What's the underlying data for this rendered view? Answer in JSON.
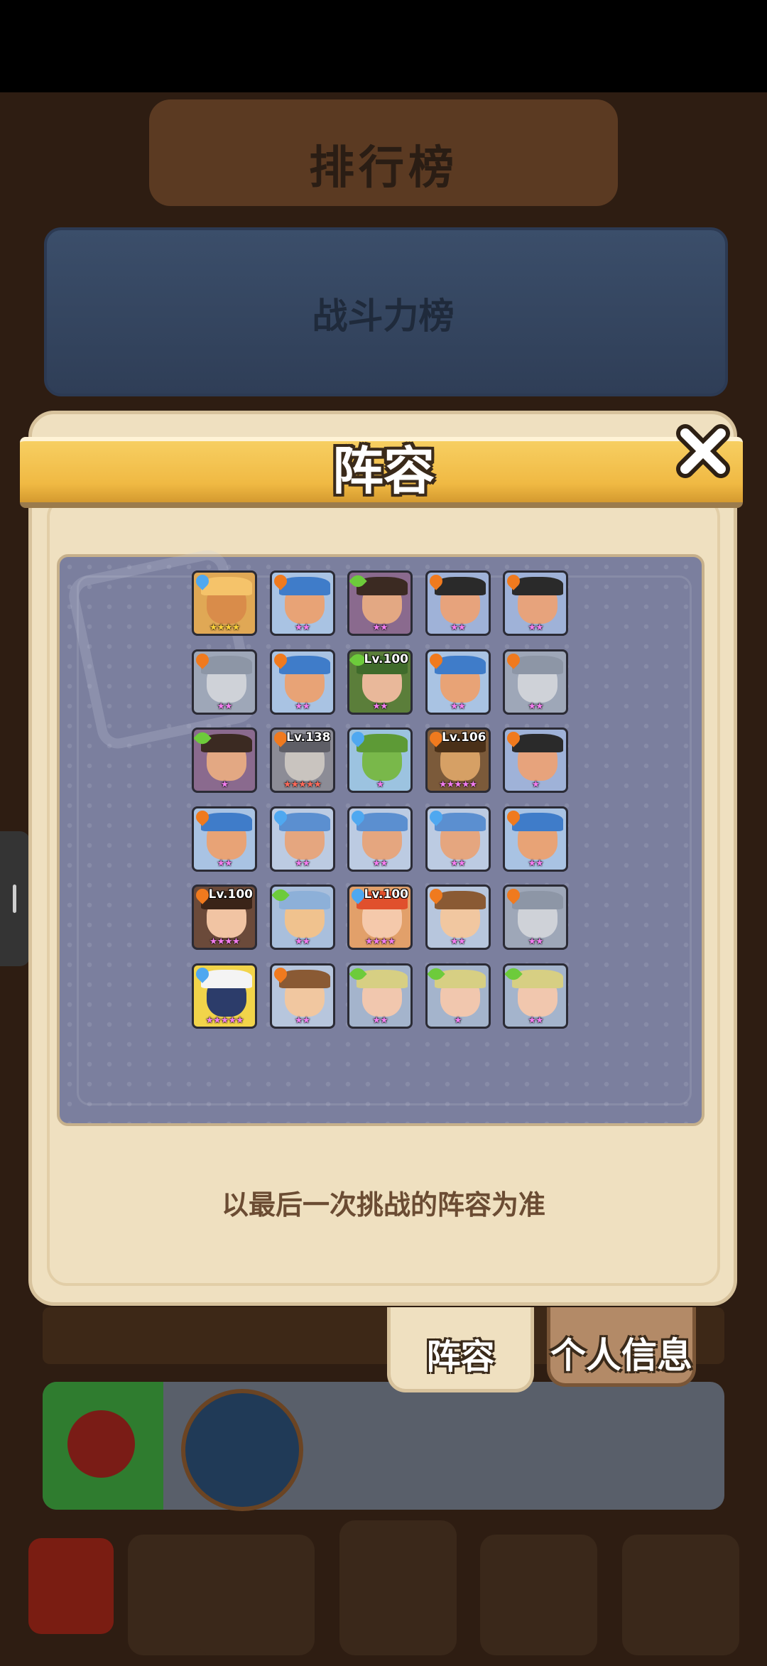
{
  "background": {
    "banner_title": "排行榜",
    "ranking_card_title": "战斗力榜"
  },
  "dialog": {
    "title": "阵容",
    "note": "以最后一次挑战的阵容为准"
  },
  "tabs": [
    {
      "label": "阵容",
      "selected": true
    },
    {
      "label": "个人信息",
      "selected": false
    }
  ],
  "heroes": [
    {
      "row": 1,
      "col": 1,
      "element": "water",
      "stars": "★★★★",
      "star_color": "gold",
      "level": "",
      "portrait": "golden-bunny-brute"
    },
    {
      "row": 1,
      "col": 2,
      "element": "fire",
      "stars": "★★",
      "star_color": "pink",
      "level": "",
      "portrait": "blue-bandana-pirate"
    },
    {
      "row": 1,
      "col": 3,
      "element": "leaf",
      "stars": "★★",
      "star_color": "pink",
      "level": "",
      "portrait": "bearded-caveman"
    },
    {
      "row": 1,
      "col": 4,
      "element": "fire",
      "stars": "★★",
      "star_color": "pink",
      "level": "",
      "portrait": "sunglasses-thug"
    },
    {
      "row": 1,
      "col": 5,
      "element": "fire",
      "stars": "★★",
      "star_color": "pink",
      "level": "",
      "portrait": "sunglasses-thug"
    },
    {
      "row": 2,
      "col": 1,
      "element": "fire",
      "stars": "★★",
      "star_color": "pink",
      "level": "",
      "portrait": "stone-golem"
    },
    {
      "row": 2,
      "col": 2,
      "element": "fire",
      "stars": "★★",
      "star_color": "pink",
      "level": "",
      "portrait": "blue-bandana-pirate"
    },
    {
      "row": 2,
      "col": 3,
      "element": "leaf",
      "stars": "★★",
      "star_color": "pink",
      "level": "Lv.100",
      "portrait": "green-hair-archer"
    },
    {
      "row": 2,
      "col": 4,
      "element": "fire",
      "stars": "★★",
      "star_color": "pink",
      "level": "",
      "portrait": "blue-bandana-pirate"
    },
    {
      "row": 2,
      "col": 5,
      "element": "fire",
      "stars": "★★",
      "star_color": "pink",
      "level": "",
      "portrait": "stone-golem"
    },
    {
      "row": 3,
      "col": 1,
      "element": "leaf",
      "stars": "★",
      "star_color": "pink",
      "level": "",
      "portrait": "bearded-caveman"
    },
    {
      "row": 3,
      "col": 2,
      "element": "fire",
      "stars": "★★★★★",
      "star_color": "red",
      "level": "Lv.138",
      "portrait": "silver-knight"
    },
    {
      "row": 3,
      "col": 3,
      "element": "water",
      "stars": "★",
      "star_color": "pink",
      "level": "",
      "portrait": "green-frog"
    },
    {
      "row": 3,
      "col": 4,
      "element": "fire",
      "stars": "★★★★★",
      "star_color": "pink",
      "level": "Lv.106",
      "portrait": "monkey-king"
    },
    {
      "row": 3,
      "col": 5,
      "element": "fire",
      "stars": "★",
      "star_color": "pink",
      "level": "",
      "portrait": "sunglasses-thug"
    },
    {
      "row": 4,
      "col": 1,
      "element": "fire",
      "stars": "★★",
      "star_color": "pink",
      "level": "",
      "portrait": "blue-bandana-pirate"
    },
    {
      "row": 4,
      "col": 2,
      "element": "water",
      "stars": "★★",
      "star_color": "pink",
      "level": "",
      "portrait": "blue-hood-soldier"
    },
    {
      "row": 4,
      "col": 3,
      "element": "water",
      "stars": "★★",
      "star_color": "pink",
      "level": "",
      "portrait": "blue-hood-soldier"
    },
    {
      "row": 4,
      "col": 4,
      "element": "water",
      "stars": "★★",
      "star_color": "pink",
      "level": "",
      "portrait": "blue-hood-soldier"
    },
    {
      "row": 4,
      "col": 5,
      "element": "fire",
      "stars": "★★",
      "star_color": "pink",
      "level": "",
      "portrait": "blue-bandana-pirate"
    },
    {
      "row": 5,
      "col": 1,
      "element": "fire",
      "stars": "★★★★",
      "star_color": "pink",
      "level": "Lv.100",
      "portrait": "dark-hair-maiden"
    },
    {
      "row": 5,
      "col": 2,
      "element": "leaf",
      "stars": "★★",
      "star_color": "pink",
      "level": "",
      "portrait": "winged-hand"
    },
    {
      "row": 5,
      "col": 3,
      "element": "water",
      "stars": "★★★★",
      "star_color": "pink",
      "level": "Lv.100",
      "portrait": "red-hair-fairy"
    },
    {
      "row": 5,
      "col": 4,
      "element": "fire",
      "stars": "★★",
      "star_color": "pink",
      "level": "",
      "portrait": "lion-mane-kid"
    },
    {
      "row": 5,
      "col": 5,
      "element": "fire",
      "stars": "★★",
      "star_color": "pink",
      "level": "",
      "portrait": "stone-golem"
    },
    {
      "row": 6,
      "col": 1,
      "element": "water",
      "stars": "★★★★★",
      "star_color": "pink",
      "level": "",
      "portrait": "white-hooded-mage"
    },
    {
      "row": 6,
      "col": 2,
      "element": "fire",
      "stars": "★★",
      "star_color": "pink",
      "level": "",
      "portrait": "lion-mane-kid"
    },
    {
      "row": 6,
      "col": 3,
      "element": "leaf",
      "stars": "★★",
      "star_color": "pink",
      "level": "",
      "portrait": "blonde-elf"
    },
    {
      "row": 6,
      "col": 4,
      "element": "leaf",
      "stars": "★",
      "star_color": "pink",
      "level": "",
      "portrait": "blonde-elf"
    },
    {
      "row": 6,
      "col": 5,
      "element": "leaf",
      "stars": "★★",
      "star_color": "pink",
      "level": "",
      "portrait": "blonde-elf"
    }
  ],
  "portrait_colors": {
    "golden-bunny-brute": {
      "bg": "#e0a855",
      "face": "#d98c4a",
      "hat": "#f5c36a"
    },
    "blue-bandana-pirate": {
      "bg": "#a9c3e3",
      "face": "#e8a376",
      "hat": "#3f7cc9"
    },
    "bearded-caveman": {
      "bg": "#8a6a8e",
      "face": "#e3a883",
      "hat": "#3b2a22"
    },
    "sunglasses-thug": {
      "bg": "#9fb2d8",
      "face": "#e7a37c",
      "hat": "#2a2a2a"
    },
    "stone-golem": {
      "bg": "#9ea7b8",
      "face": "#cfd2d8",
      "hat": "#8d96a6"
    },
    "green-hair-archer": {
      "bg": "#5b7e3a",
      "face": "#e9b89a",
      "hat": "#3f6b2b"
    },
    "silver-knight": {
      "bg": "#8c8c96",
      "face": "#c9c4bf",
      "hat": "#5e5e66"
    },
    "green-frog": {
      "bg": "#9cc3e0",
      "face": "#79b84a",
      "hat": "#5d9a36"
    },
    "monkey-king": {
      "bg": "#7b5a3a",
      "face": "#d6a065",
      "hat": "#4a3018"
    },
    "blue-hood-soldier": {
      "bg": "#bccbe2",
      "face": "#e5a67f",
      "hat": "#5b8fd0"
    },
    "dark-hair-maiden": {
      "bg": "#6b4a3a",
      "face": "#f1c4a3",
      "hat": "#3a2418"
    },
    "winged-hand": {
      "bg": "#a9bfdc",
      "face": "#f0c28e",
      "hat": "#8db0d8"
    },
    "red-hair-fairy": {
      "bg": "#e2a06a",
      "face": "#f5c9ab",
      "hat": "#e0502d"
    },
    "lion-mane-kid": {
      "bg": "#b7c6dd",
      "face": "#f1c7a0",
      "hat": "#8a5a34"
    },
    "white-hooded-mage": {
      "bg": "#f2d44a",
      "face": "#2c3c6a",
      "hat": "#f4f4f4"
    },
    "blonde-elf": {
      "bg": "#a4b4cc",
      "face": "#f1c7ae",
      "hat": "#d7cf83"
    }
  }
}
